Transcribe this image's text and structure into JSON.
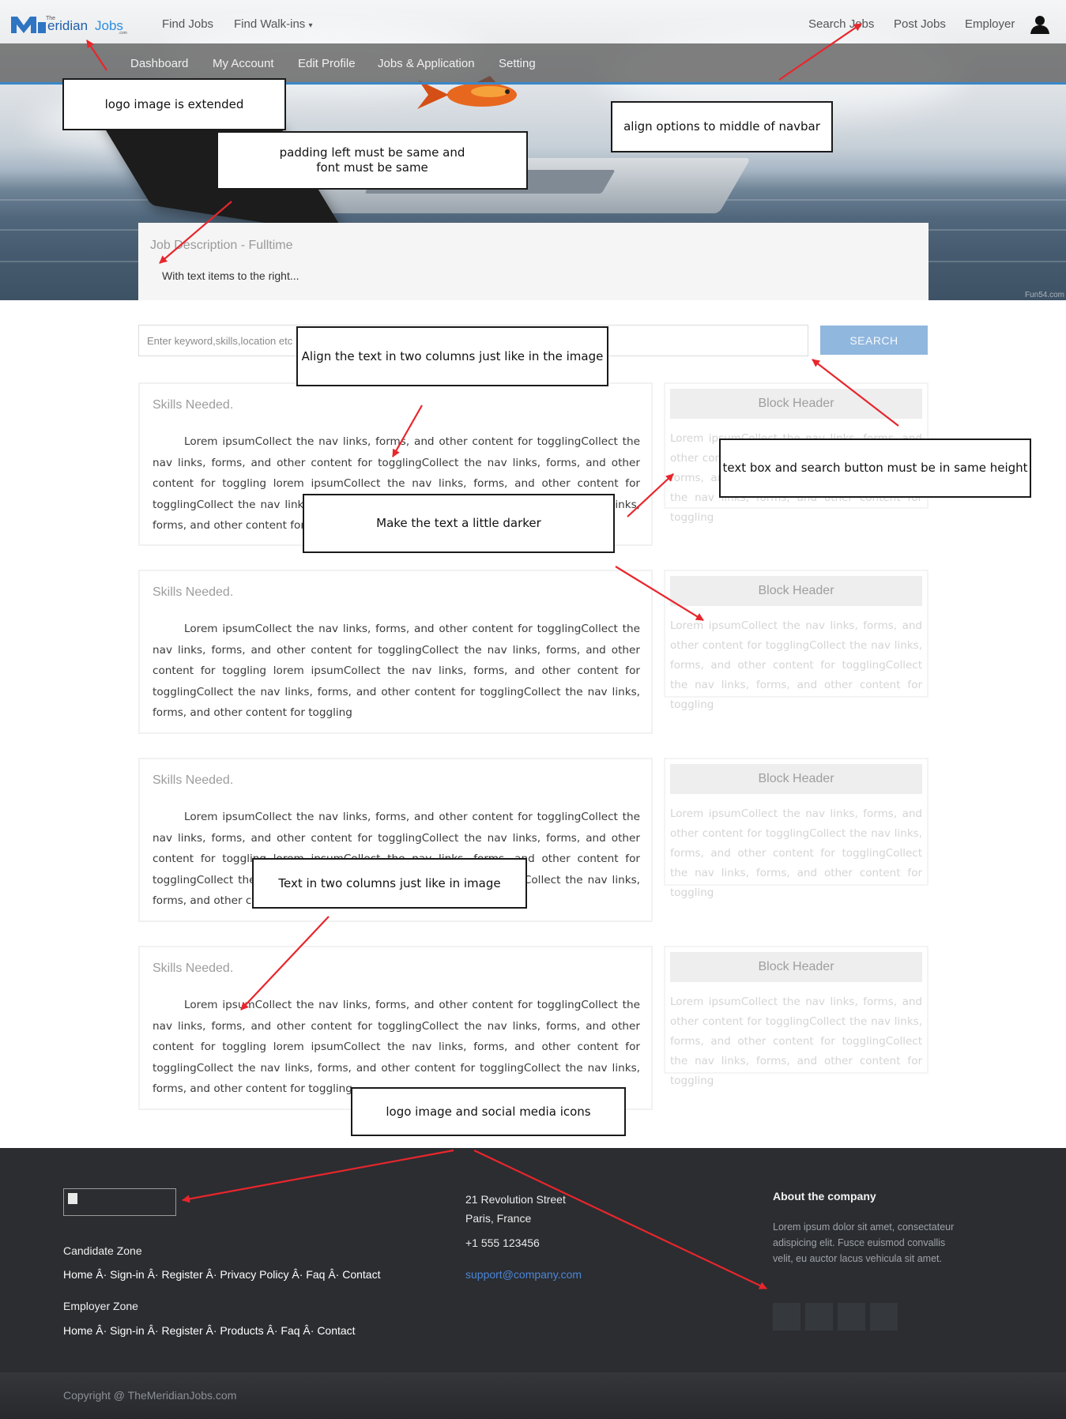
{
  "header": {
    "logo_text": "TheMeridianJobs.com",
    "nav_left": [
      "Find Jobs",
      "Find Walk-ins"
    ],
    "nav_right": [
      "Search Jobs",
      "Post Jobs",
      "Employer"
    ],
    "subnav": [
      "Dashboard",
      "My Account",
      "Edit Profile",
      "Jobs & Application",
      "Setting"
    ]
  },
  "hero": {
    "job_title": "Job Description - Fulltime",
    "job_subtitle": "With text items to the right...",
    "watermark": "Fun54.com"
  },
  "search": {
    "placeholder": "Enter keyword,skills,location etc",
    "button_label": "SEARCH"
  },
  "cards": [
    {
      "title": "Skills Needed.",
      "body": "Lorem ipsumCollect the nav links, forms, and other content for togglingCollect the nav links, forms, and other content for togglingCollect the nav links, forms, and other content for toggling lorem ipsumCollect the nav links, forms, and other content for togglingCollect the nav links, forms, and other content for togglingCollect the nav links, forms, and other content for toggling"
    },
    {
      "title": "Skills Needed.",
      "body": "Lorem ipsumCollect the nav links, forms, and other content for togglingCollect the nav links, forms, and other content for togglingCollect the nav links, forms, and other content for toggling lorem ipsumCollect the nav links, forms, and other content for togglingCollect the nav links, forms, and other content for togglingCollect the nav links, forms, and other content for toggling"
    },
    {
      "title": "Skills Needed.",
      "body": "Lorem ipsumCollect the nav links, forms, and other content for togglingCollect the nav links, forms, and other content for togglingCollect the nav links, forms, and other content for toggling lorem ipsumCollect the nav links, forms, and other content for togglingCollect the nav links, forms, and other content for togglingCollect the nav links, forms, and other content for toggling"
    },
    {
      "title": "Skills Needed.",
      "body": "Lorem ipsumCollect the nav links, forms, and other content for togglingCollect the nav links, forms, and other content for togglingCollect the nav links, forms, and other content for toggling lorem ipsumCollect the nav links, forms, and other content for togglingCollect the nav links, forms, and other content for togglingCollect the nav links, forms, and other content for toggling"
    }
  ],
  "side_blocks": [
    {
      "header": "Block Header",
      "body": "Lorem ipsumCollect the nav links, forms, and other content for togglingCollect the nav links, forms, and other content for togglingCollect the nav links, forms, and other content for toggling"
    },
    {
      "header": "Block Header",
      "body": "Lorem ipsumCollect the nav links, forms, and other content for togglingCollect the nav links, forms, and other content for togglingCollect the nav links, forms, and other content for toggling"
    },
    {
      "header": "Block Header",
      "body": "Lorem ipsumCollect the nav links, forms, and other content for togglingCollect the nav links, forms, and other content for togglingCollect the nav links, forms, and other content for toggling"
    },
    {
      "header": "Block Header",
      "body": "Lorem ipsumCollect the nav links, forms, and other content for togglingCollect the nav links, forms, and other content for togglingCollect the nav links, forms, and other content for toggling"
    }
  ],
  "annotations": {
    "logo": "logo image is extended",
    "padding": "padding left must be same and font must be same",
    "align_nav": "align options to middle of navbar",
    "two_columns": "Align the text in two columns just like in the image",
    "search_height": "text box and search button must be in same height",
    "darker": "Make the text a little darker",
    "two_columns_b": "Text in two columns just like in image",
    "footer_logo": "logo image and social media icons"
  },
  "footer": {
    "candidate_heading": "Candidate Zone",
    "candidate_links": "Home Â· Sign-in Â· Register Â· Privacy Policy Â· Faq Â· Contact",
    "employer_heading": "Employer Zone",
    "employer_links": "Home Â· Sign-in Â· Register Â· Products Â· Faq Â· Contact",
    "address_line1": "21 Revolution Street",
    "address_line2": "Paris, France",
    "phone": "+1 555 123456",
    "email": "support@company.com",
    "about_heading": "About the company",
    "about_text": "Lorem ipsum dolor sit amet, consectateur adispicing elit. Fusce euismod convallis velit, eu auctor lacus vehicula sit amet.",
    "copyright": "Copyright @ TheMeridianJobs.com"
  },
  "colors": {
    "accent_blue": "#3a87c8",
    "search_button": "#90b7de",
    "footer_bg": "#2b2d31",
    "arrow_red": "#e8262c"
  }
}
